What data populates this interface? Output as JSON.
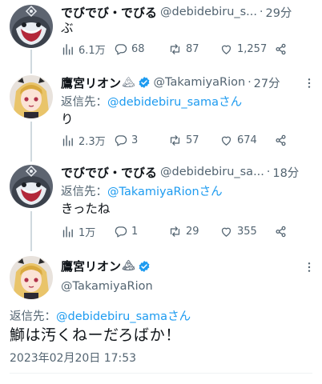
{
  "colors": {
    "link": "#1d9bf0",
    "verified": "#1d9bf0",
    "muted": "#536471",
    "text": "#0f1419",
    "thread_line": "#cfd9de"
  },
  "tweets": [
    {
      "display_name": "でびでび・でびる",
      "handle": "@debidebiru_s...",
      "dot": "·",
      "time": "29分",
      "text": "ぶ",
      "views": "6.1万",
      "replies": "68",
      "retweets": "87",
      "likes": "1,257",
      "avatar_icon": "devil-avatar"
    },
    {
      "display_name": "鷹宮リオン",
      "name_emoji": "🏔",
      "verified_icon": "verified-badge-icon",
      "handle": "@TakamiyaRion",
      "dot": "·",
      "time": "27分",
      "reply_prefix": "返信先：",
      "reply_handle": "@debidebiru_samaさん",
      "text": "り",
      "views": "2.3万",
      "replies": "3",
      "retweets": "57",
      "likes": "674",
      "avatar_icon": "blonde-girl-avatar"
    },
    {
      "display_name": "でびでび・でびる",
      "handle": "@debidebiru_sa...",
      "dot": "·",
      "time": "18分",
      "reply_prefix": "返信先：",
      "reply_handle": "@TakamiyaRionさん",
      "text": "きったね",
      "views": "1万",
      "replies": "1",
      "retweets": "29",
      "likes": "355",
      "avatar_icon": "devil-avatar"
    }
  ],
  "main_tweet": {
    "display_name": "鷹宮リオン",
    "name_emoji": "🏔",
    "handle": "@TakamiyaRion",
    "reply_prefix": "返信先：",
    "reply_handle": "@debidebiru_samaさん",
    "text": "鰤は汚くねーだろばか！",
    "date": "2023年02月20日 17:53"
  }
}
